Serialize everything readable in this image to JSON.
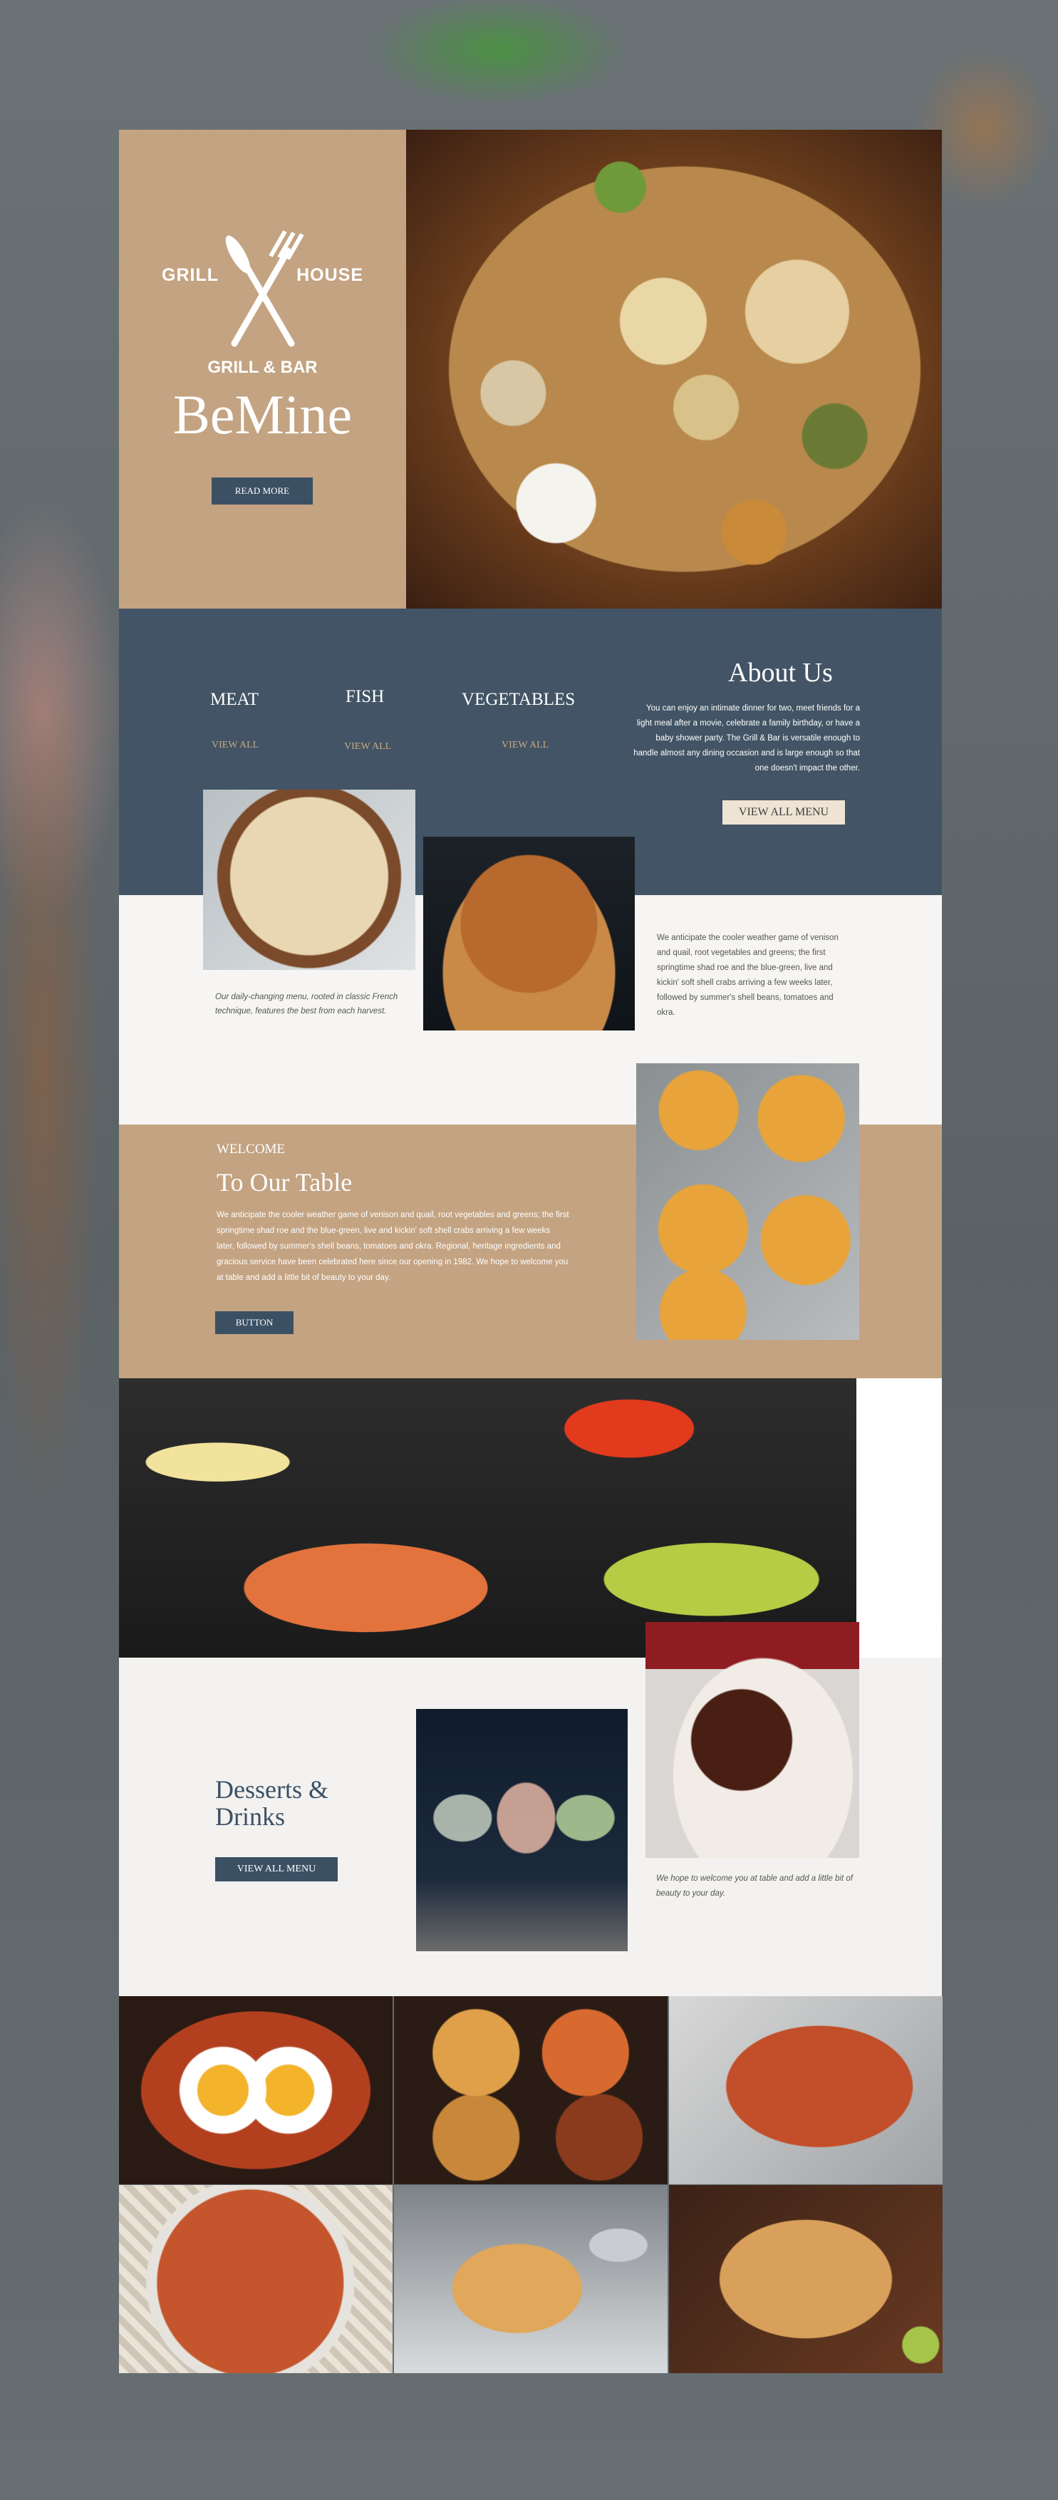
{
  "hero": {
    "logo_left": "GRILL",
    "logo_right": "HOUSE",
    "logo_sub": "GRILL & BAR",
    "brand": "BeMine",
    "read_more": "READ MORE"
  },
  "categories": [
    {
      "label": "MEAT",
      "link": "VIEW ALL"
    },
    {
      "label": "FISH",
      "link": "VIEW ALL"
    },
    {
      "label": "VEGETABLES",
      "link": "VIEW ALL"
    }
  ],
  "about": {
    "title": "About Us",
    "text": "You can enjoy an intimate dinner for two, meet friends for a light meal after a movie, celebrate a family birthday, or have a baby shower party. The Grill & Bar is versatile enough to handle almost any dining occasion and is large enough so that one doesn't impact the other.",
    "button": "VIEW ALL MENU"
  },
  "pizza_caption": "Our daily-changing menu, rooted in classic French technique, features the best from each harvest.",
  "white_text": "We anticipate the cooler weather game of venison and quail, root vegetables and greens; the first springtime shad roe and the blue-green, live and kickin' soft shell crabs arriving a few weeks later, followed by summer's shell beans, tomatoes and okra.",
  "welcome": {
    "small": "WELCOME",
    "title": "To Our Table",
    "text": "We anticipate the cooler weather game of venison and quail, root vegetables and greens; the first springtime shad roe and the blue-green, live and kickin' soft shell crabs arriving a few weeks later, followed by summer's shell beans, tomatoes and okra. Regional, heritage ingredients and gracious service have been celebrated here since our opening in 1982. We hope to welcome you at table and add a little bit of beauty to your day.",
    "button": "BUTTON"
  },
  "desserts": {
    "title": "Desserts & Drinks",
    "button": "VIEW ALL MENU",
    "caption": "We hope to welcome you at table and add a little bit of beauty to your day."
  }
}
